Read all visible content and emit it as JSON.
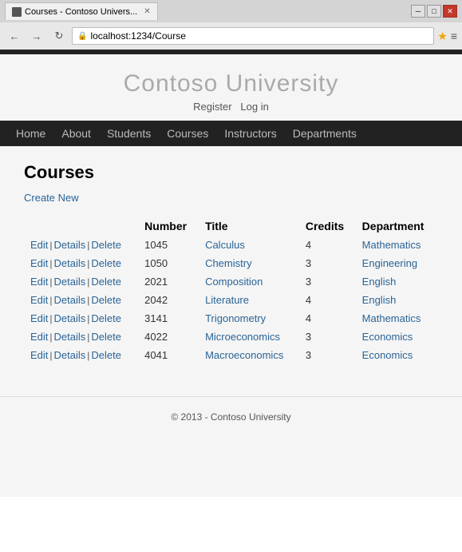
{
  "browser": {
    "tab_title": "Courses - Contoso Univers...",
    "address": "localhost:1234/Course",
    "minimize_label": "─",
    "maximize_label": "□",
    "close_label": "✕",
    "back_label": "←",
    "forward_label": "→",
    "refresh_label": "↻"
  },
  "site": {
    "title": "Contoso University",
    "auth": {
      "register": "Register",
      "login": "Log in"
    },
    "nav": [
      "Home",
      "About",
      "Students",
      "Courses",
      "Instructors",
      "Departments"
    ]
  },
  "page": {
    "heading": "Courses",
    "create_new": "Create New",
    "table": {
      "headers": [
        "Number",
        "Title",
        "Credits",
        "Department"
      ],
      "rows": [
        {
          "number": "1045",
          "title": "Calculus",
          "credits": "4",
          "department": "Mathematics"
        },
        {
          "number": "1050",
          "title": "Chemistry",
          "credits": "3",
          "department": "Engineering"
        },
        {
          "number": "2021",
          "title": "Composition",
          "credits": "3",
          "department": "English"
        },
        {
          "number": "2042",
          "title": "Literature",
          "credits": "4",
          "department": "English"
        },
        {
          "number": "3141",
          "title": "Trigonometry",
          "credits": "4",
          "department": "Mathematics"
        },
        {
          "number": "4022",
          "title": "Microeconomics",
          "credits": "3",
          "department": "Economics"
        },
        {
          "number": "4041",
          "title": "Macroeconomics",
          "credits": "3",
          "department": "Economics"
        }
      ],
      "actions": [
        "Edit",
        "Details",
        "Delete"
      ]
    }
  },
  "footer": {
    "text": "© 2013 - Contoso University"
  }
}
